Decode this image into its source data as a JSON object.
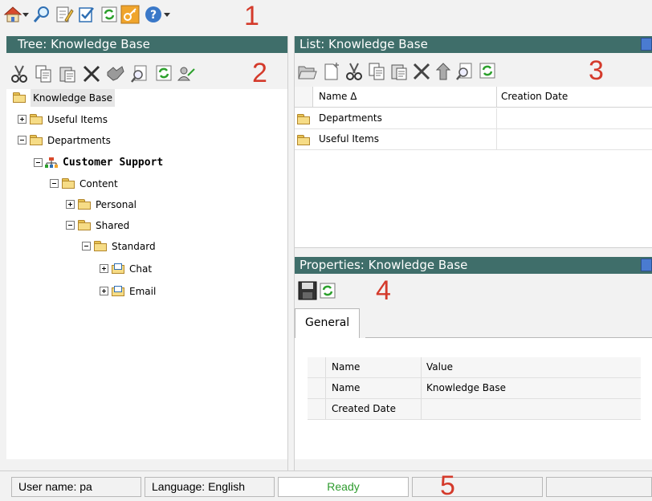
{
  "callouts": [
    "1",
    "2",
    "3",
    "4",
    "5"
  ],
  "toolbar": {
    "icons": [
      "home-icon",
      "dropdown-arrow-icon",
      "search-icon",
      "edit-document-icon",
      "checklist-icon",
      "refresh-icon",
      "key-icon",
      "help-icon",
      "dropdown-arrow-icon"
    ]
  },
  "tree": {
    "title": "Tree: Knowledge Base",
    "toolbar_icons": [
      "cut-icon",
      "copy-icon",
      "paste-icon",
      "delete-icon",
      "handshake-icon",
      "find-icon",
      "refresh-icon",
      "permissions-icon"
    ],
    "nodes": [
      {
        "label": "Knowledge Base",
        "bold": false
      },
      {
        "label": "Useful Items",
        "bold": false
      },
      {
        "label": "Departments",
        "bold": false
      },
      {
        "label": "Customer Support",
        "bold": true
      },
      {
        "label": "Content",
        "bold": false
      },
      {
        "label": "Personal",
        "bold": false
      },
      {
        "label": "Shared",
        "bold": false
      },
      {
        "label": "Standard",
        "bold": false
      },
      {
        "label": "Chat",
        "bold": false
      },
      {
        "label": "Email",
        "bold": false
      }
    ]
  },
  "list": {
    "title": "List: Knowledge Base",
    "toolbar_icons": [
      "open-folder-icon",
      "new-document-icon",
      "cut-icon",
      "copy-icon",
      "paste-icon",
      "delete-icon",
      "move-up-icon",
      "find-icon",
      "refresh-icon"
    ],
    "columns": [
      "Name Δ",
      "Creation Date"
    ],
    "rows": [
      {
        "name": "Departments",
        "date": ""
      },
      {
        "name": "Useful Items",
        "date": ""
      }
    ]
  },
  "properties": {
    "title": "Properties: Knowledge Base",
    "toolbar_icons": [
      "save-icon",
      "refresh-icon"
    ],
    "tab": "General",
    "columns": [
      "Name",
      "Value"
    ],
    "rows": [
      {
        "name": "Name",
        "value": "Knowledge Base"
      },
      {
        "name": "Created Date",
        "value": ""
      }
    ]
  },
  "status": {
    "user": "User name: pa",
    "language": "Language: English",
    "state": "Ready",
    "state_color": "#2e9b2e"
  },
  "colors": {
    "header_bg": "#3f6e6a",
    "callout": "#d43a2b",
    "chrome_bg": "#f2f2f2"
  }
}
